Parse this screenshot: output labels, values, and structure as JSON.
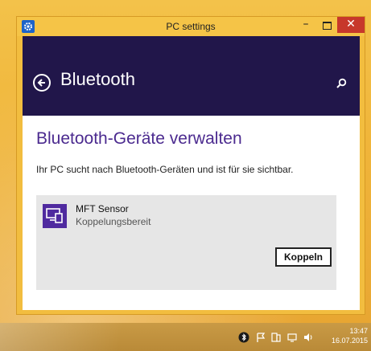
{
  "window": {
    "title": "PC settings",
    "controls": {
      "minimize": "–",
      "close": "✕"
    }
  },
  "header": {
    "title": "Bluetooth"
  },
  "main": {
    "heading": "Bluetooth-Geräte verwalten",
    "description": "Ihr PC sucht nach Bluetooth-Geräten und ist für sie sichtbar.",
    "device": {
      "name": "MFT Sensor",
      "status": "Koppelungsbereit",
      "icon": "device-icon",
      "action_label": "Koppeln"
    }
  },
  "taskbar": {
    "clock_time": "13:47",
    "clock_date": "16.07.2015"
  },
  "colors": {
    "header_bg": "#21164a",
    "accent": "#4b2a8f",
    "window_frame": "#f2bd3f",
    "close_button": "#c7382b"
  }
}
